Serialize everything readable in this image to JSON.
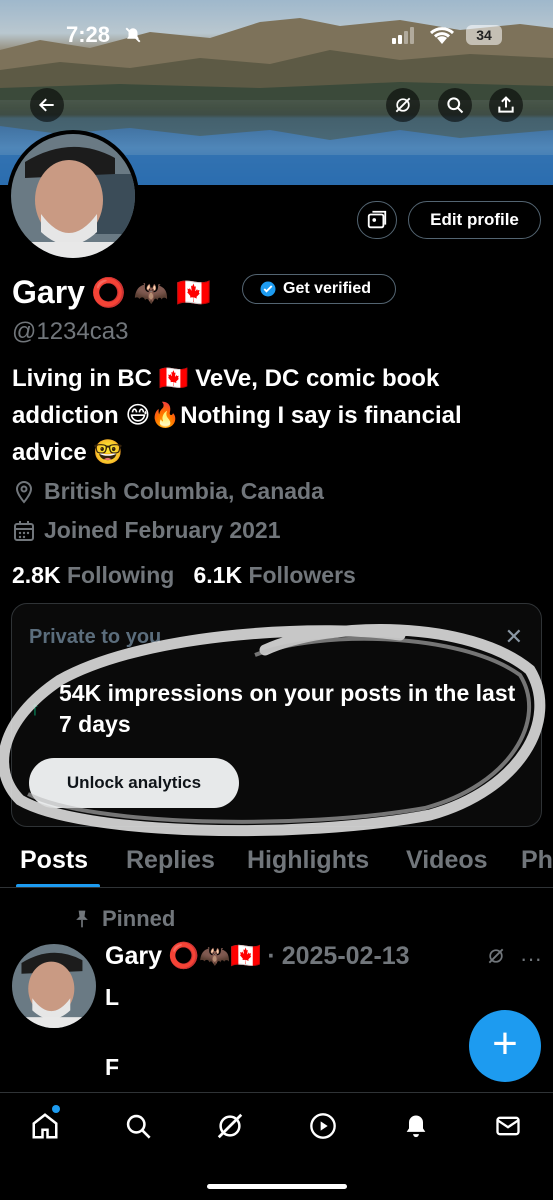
{
  "status_bar": {
    "time": "7:28",
    "battery": "34"
  },
  "profile": {
    "name": "Gary",
    "name_emojis": "⭕ 🦇 🇨🇦",
    "handle": "@1234ca3",
    "bio": "Living in BC 🇨🇦 VeVe, DC comic book addiction 😅🔥Nothing I say is financial advice 🤓",
    "location": "British Columbia, Canada",
    "joined": "Joined February 2021",
    "following_count": "2.8K",
    "following_label": "Following",
    "followers_count": "6.1K",
    "followers_label": "Followers"
  },
  "actions": {
    "edit_profile": "Edit profile",
    "get_verified": "Get verified"
  },
  "private_card": {
    "title": "Private to you",
    "impressions": "54K impressions on your posts in the last 7 days",
    "unlock": "Unlock analytics"
  },
  "tabs": [
    "Posts",
    "Replies",
    "Highlights",
    "Videos",
    "Ph"
  ],
  "pinned_post": {
    "pinned_label": "Pinned",
    "author": "Gary",
    "author_emojis": "⭕🦇🇨🇦",
    "separator": "·",
    "date": "2025-02-13",
    "line1": "L",
    "line2": "F"
  },
  "fab_label": "+",
  "colors": {
    "accent": "#1d9bf0",
    "up_arrow": "#00ba7c",
    "muted": "#71767b"
  },
  "nav_icons": [
    "home-icon",
    "search-icon",
    "grok-icon",
    "play-icon",
    "bell-icon",
    "mail-icon"
  ]
}
